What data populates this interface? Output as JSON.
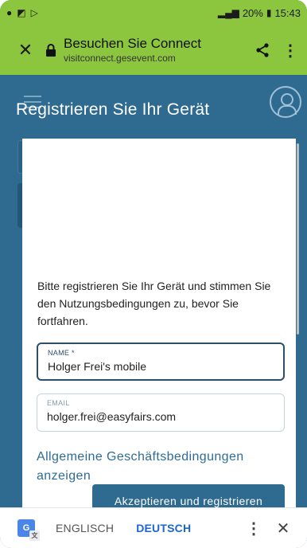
{
  "status_bar": {
    "battery": "20%",
    "time": "15:43"
  },
  "browser": {
    "title": "Besuchen Sie Connect",
    "url": "visitconnect.gesevent.com",
    "accent_color": "#8cc63f"
  },
  "page": {
    "title": "Registrieren Sie Ihr Gerät"
  },
  "modal": {
    "intro": "Bitte registrieren Sie Ihr Gerät und stimmen Sie den Nutzungsbedingungen zu, bevor Sie fortfahren.",
    "name_label": "NAME *",
    "name_value": "Holger Frei's mobile",
    "email_label": "EMAIL",
    "email_value": "holger.frei@easyfairs.com",
    "terms_link": "Allgemeine Geschäftsbedingungen anzeigen",
    "accept_button": "Akzeptieren und registrieren"
  },
  "translate_bar": {
    "source_lang": "ENGLISCH",
    "target_lang": "DEUTSCH"
  },
  "icons": [
    "close-icon",
    "lock-icon",
    "share-icon",
    "more-icon",
    "menu-icon",
    "user-icon",
    "google-translate-icon"
  ]
}
